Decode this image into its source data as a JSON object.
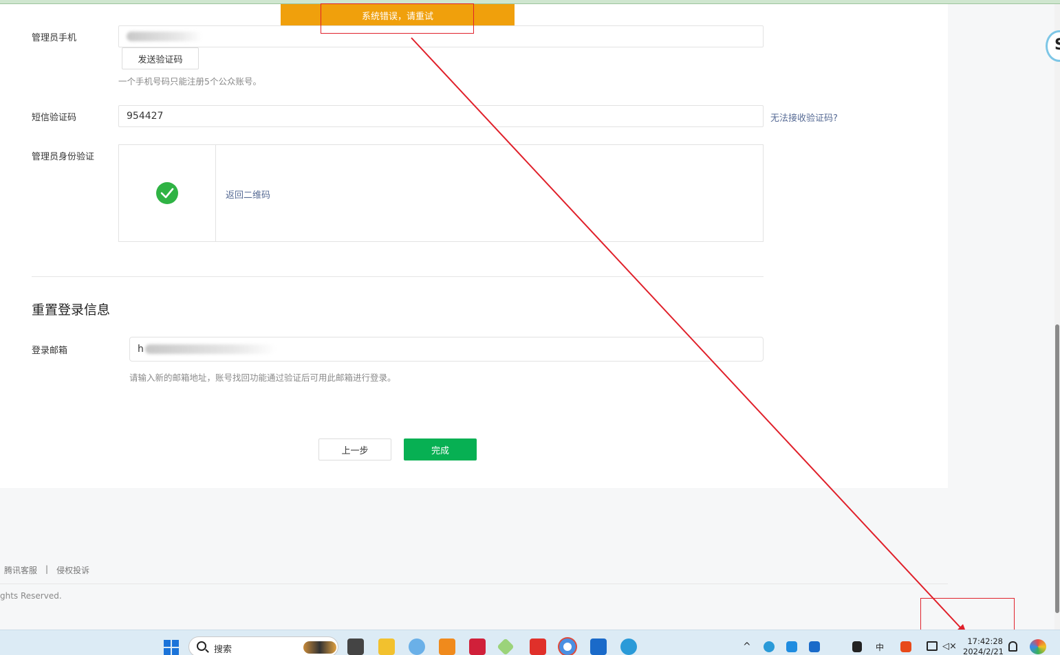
{
  "toast": {
    "message": "系统错误，请重试"
  },
  "form": {
    "phone_label": "管理员手机",
    "send_code_button": "发送验证码",
    "phone_hint": "一个手机号码只能注册5个公众账号。",
    "sms_label": "短信验证码",
    "sms_value": "954427",
    "sms_help_link": "无法接收验证码?",
    "identity_label": "管理员身份验证",
    "back_qr_link": "返回二维码"
  },
  "reset_section": {
    "title": "重置登录信息",
    "email_label": "登录邮箱",
    "email_visible_prefix": "h",
    "email_hint": "请输入新的邮箱地址，账号找回功能通过验证后可用此邮箱进行登录。"
  },
  "actions": {
    "prev_button": "上一步",
    "finish_button": "完成"
  },
  "footer": {
    "links": [
      "腾讯客服",
      "|",
      "侵权投诉"
    ],
    "copyright": "ghts Reserved."
  },
  "taskbar": {
    "search_label": "搜索",
    "ime_label": "中",
    "time": "17:42:28",
    "date": "2024/2/21"
  },
  "colors": {
    "toast_bg": "#f0a00c",
    "primary_button": "#07b053",
    "link": "#576b95",
    "annotation_red": "#e0202a",
    "success_check": "#2fb344"
  },
  "icons": [
    "checkmark-icon",
    "windows-start-icon",
    "search-icon",
    "chevron-up-icon",
    "notification-bell-icon",
    "speaker-muted-icon",
    "network-icon"
  ]
}
